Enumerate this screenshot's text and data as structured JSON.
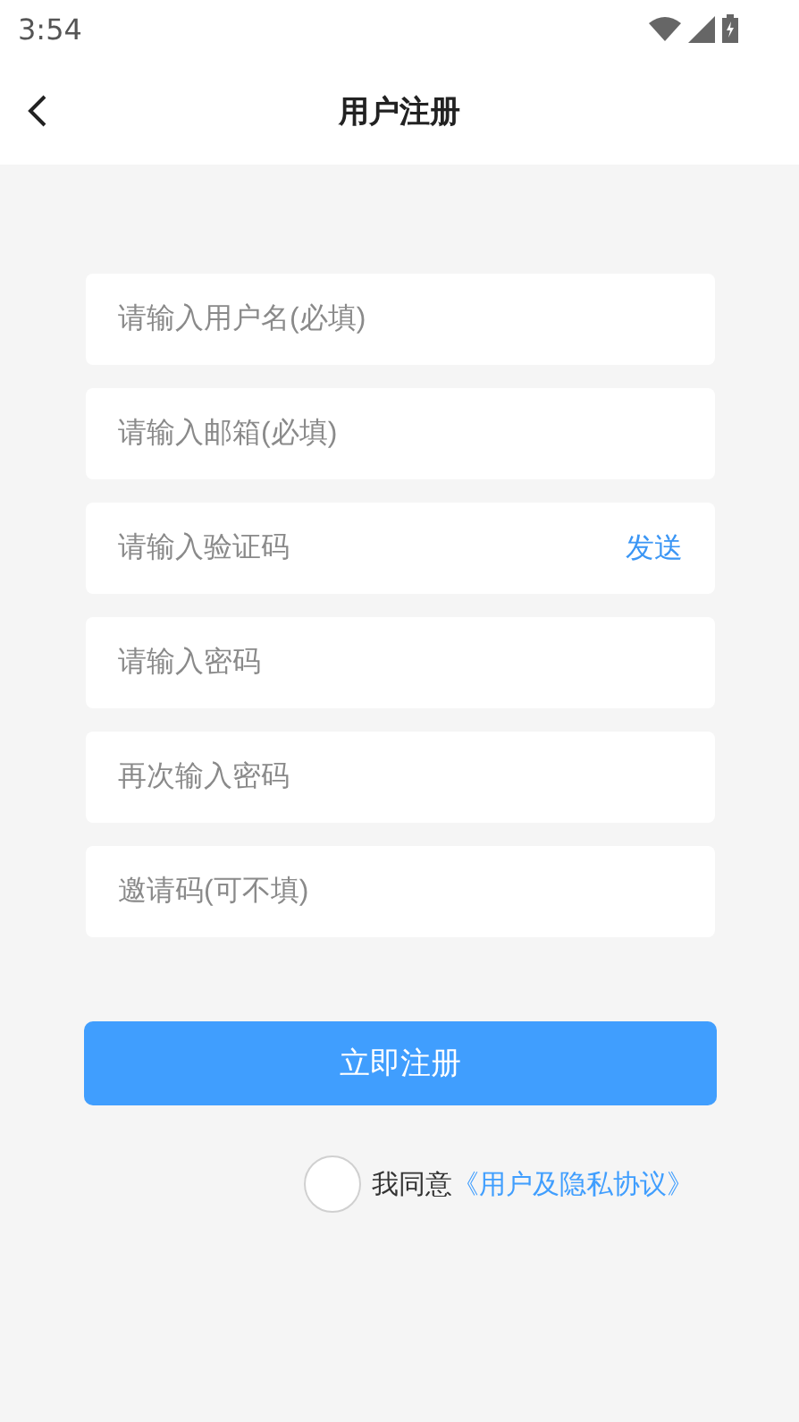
{
  "status_bar": {
    "time": "3:54"
  },
  "header": {
    "title": "用户注册"
  },
  "fields": [
    {
      "placeholder": "请输入用户名(必填)"
    },
    {
      "placeholder": "请输入邮箱(必填)"
    },
    {
      "placeholder": "请输入验证码",
      "action": "发送"
    },
    {
      "placeholder": "请输入密码"
    },
    {
      "placeholder": "再次输入密码"
    },
    {
      "placeholder": "邀请码(可不填)"
    }
  ],
  "submit": "立即注册",
  "agreement": {
    "checked": false,
    "text": "我同意",
    "link": "《用户及隐私协议》"
  }
}
